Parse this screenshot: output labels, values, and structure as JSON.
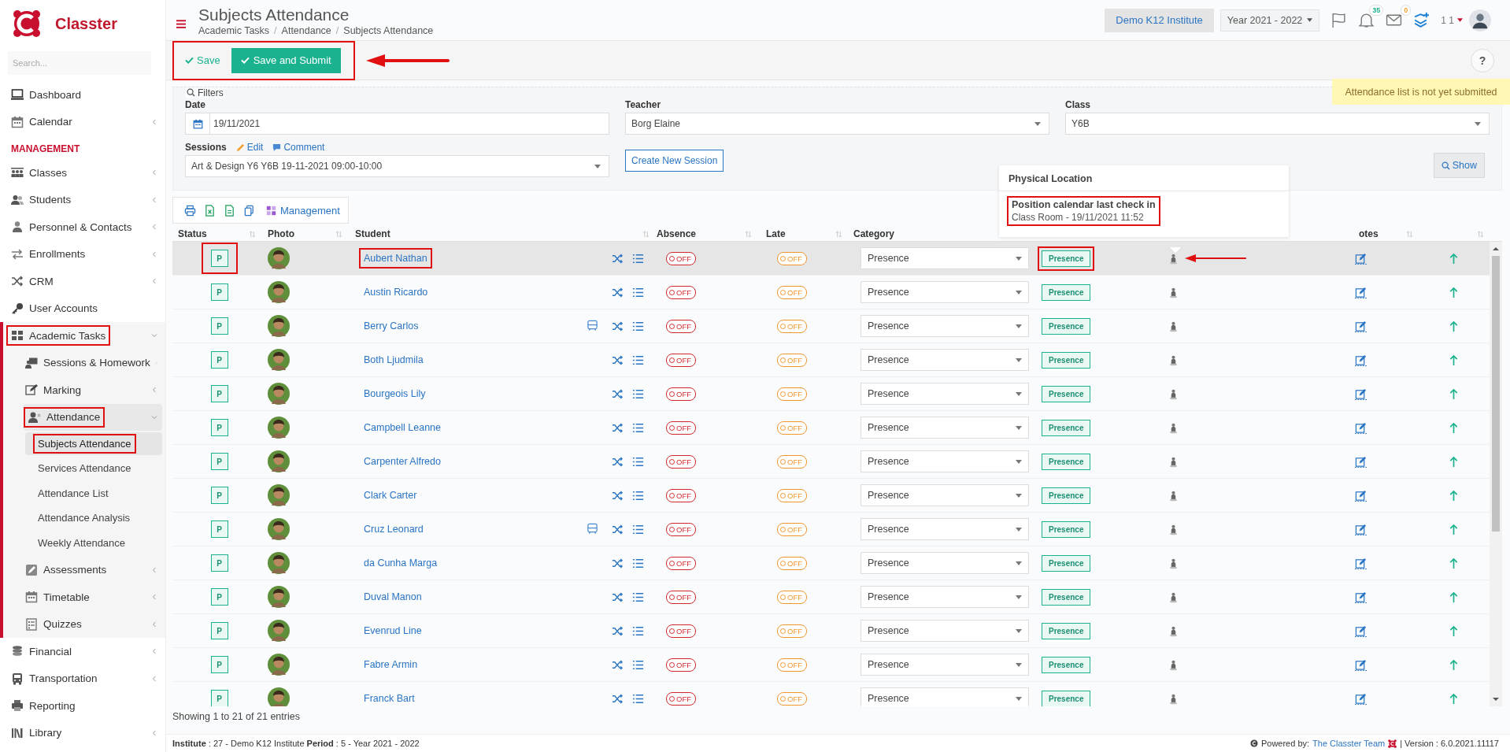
{
  "sidebar": {
    "brand": "Classter",
    "search": {
      "placeholder": "Search..."
    },
    "items": [
      {
        "kind": "link",
        "label": "Dashboard",
        "selected": false
      },
      {
        "kind": "link",
        "label": "Calendar",
        "expanded": false,
        "selected": false
      },
      {
        "kind": "section",
        "label": "MANAGEMENT"
      },
      {
        "kind": "link",
        "label": "Classes",
        "expanded": false,
        "selected": false
      },
      {
        "kind": "link",
        "label": "Students",
        "expanded": false,
        "selected": false
      },
      {
        "kind": "link",
        "label": "Personnel & Contacts",
        "expanded": false,
        "selected": false
      },
      {
        "kind": "link",
        "label": "Enrollments",
        "expanded": false,
        "selected": false
      },
      {
        "kind": "link",
        "label": "CRM",
        "expanded": false,
        "selected": false
      },
      {
        "kind": "link",
        "label": "User Accounts",
        "selected": false
      },
      {
        "kind": "link",
        "label": "Academic Tasks",
        "expanded": true,
        "selected": false,
        "annotated": true,
        "children": [
          {
            "label": "Sessions & Homework",
            "expanded": false,
            "selected": false
          },
          {
            "label": "Marking",
            "expanded": false,
            "selected": false
          },
          {
            "label": "Attendance",
            "expanded": true,
            "selected": true,
            "annotated": true,
            "children": [
              {
                "label": "Subjects Attendance",
                "selected": true,
                "annotated": true
              },
              {
                "label": "Services Attendance",
                "selected": false
              },
              {
                "label": "Attendance List",
                "selected": false
              },
              {
                "label": "Attendance Analysis",
                "selected": false
              },
              {
                "label": "Weekly Attendance",
                "selected": false
              }
            ]
          },
          {
            "label": "Assessments",
            "expanded": false,
            "selected": false
          },
          {
            "label": "Timetable",
            "expanded": false,
            "selected": false
          },
          {
            "label": "Quizzes",
            "expanded": false,
            "selected": false
          }
        ]
      },
      {
        "kind": "link",
        "label": "Financial",
        "expanded": false,
        "selected": false
      },
      {
        "kind": "link",
        "label": "Transportation",
        "expanded": false,
        "selected": false
      },
      {
        "kind": "link",
        "label": "Reporting",
        "selected": false
      },
      {
        "kind": "link",
        "label": "Library",
        "expanded": false,
        "selected": false
      }
    ]
  },
  "header": {
    "title": "Subjects Attendance",
    "breadcrumbs": [
      "Academic Tasks",
      "Attendance",
      "Subjects Attendance"
    ],
    "separator": "/",
    "institute": "Demo K12 Institute",
    "year": "Year 2021 - 2022",
    "notifications": "35",
    "messages": "0",
    "user": "1 1"
  },
  "toolbar": {
    "annotated": true,
    "save": "Save",
    "save_submit": "Save and Submit",
    "help": "?"
  },
  "notice": "Attendance list is not yet submitted",
  "filters": {
    "legend": "Filters",
    "date": {
      "label": "Date",
      "value": "19/11/2021"
    },
    "teacher": {
      "label": "Teacher",
      "value": "Borg Elaine"
    },
    "class": {
      "label": "Class",
      "value": "Y6B"
    },
    "sessions": {
      "label": "Sessions",
      "edit": "Edit",
      "comment": "Comment",
      "value": "Art & Design Y6 Y6B 19-11-2021 09:00-10:00"
    },
    "create_session": "Create New Session",
    "show": "Show"
  },
  "table": {
    "management": "Management",
    "columns": [
      {
        "label": "Status",
        "sortable": true
      },
      {
        "label": "Photo",
        "sortable": true
      },
      {
        "label": "Student",
        "sortable": false
      },
      {
        "sortable": true
      },
      {
        "label": "Absence",
        "sortable": true
      },
      {
        "label": "Late",
        "sortable": true
      },
      {
        "label": "Category",
        "sortable": false
      },
      {
        "label": "otes",
        "sortable": true
      },
      {
        "sortable": true
      }
    ],
    "popover": {
      "title": "Physical Location",
      "heading": "Position calendar last check in",
      "detail": "Class Room - 19/11/2021 11:52",
      "annotated": true
    },
    "rows": [
      {
        "status": "P",
        "name": "Aubert Nathan",
        "transport": false,
        "absence": "OFF",
        "absent": false,
        "late_text": "OFF",
        "late": false,
        "category": "Presence",
        "badge": "Presence",
        "selected": true,
        "annotated": true
      },
      {
        "status": "P",
        "name": "Austin Ricardo",
        "transport": false,
        "absence": "OFF",
        "absent": false,
        "late_text": "OFF",
        "late": false,
        "category": "Presence",
        "badge": "Presence",
        "selected": false
      },
      {
        "status": "P",
        "name": "Berry Carlos",
        "transport": true,
        "absence": "OFF",
        "absent": false,
        "late_text": "OFF",
        "late": false,
        "category": "Presence",
        "badge": "Presence",
        "selected": false
      },
      {
        "status": "P",
        "name": "Both Ljudmila",
        "transport": false,
        "absence": "OFF",
        "absent": false,
        "late_text": "OFF",
        "late": false,
        "category": "Presence",
        "badge": "Presence",
        "selected": false
      },
      {
        "status": "P",
        "name": "Bourgeois Lily",
        "transport": false,
        "absence": "OFF",
        "absent": false,
        "late_text": "OFF",
        "late": false,
        "category": "Presence",
        "badge": "Presence",
        "selected": false
      },
      {
        "status": "P",
        "name": "Campbell Leanne",
        "transport": false,
        "absence": "OFF",
        "absent": false,
        "late_text": "OFF",
        "late": false,
        "category": "Presence",
        "badge": "Presence",
        "selected": false
      },
      {
        "status": "P",
        "name": "Carpenter Alfredo",
        "transport": false,
        "absence": "OFF",
        "absent": false,
        "late_text": "OFF",
        "late": false,
        "category": "Presence",
        "badge": "Presence",
        "selected": false
      },
      {
        "status": "P",
        "name": "Clark Carter",
        "transport": false,
        "absence": "OFF",
        "absent": false,
        "late_text": "OFF",
        "late": false,
        "category": "Presence",
        "badge": "Presence",
        "selected": false
      },
      {
        "status": "P",
        "name": "Cruz Leonard",
        "transport": true,
        "absence": "OFF",
        "absent": false,
        "late_text": "OFF",
        "late": false,
        "category": "Presence",
        "badge": "Presence",
        "selected": false
      },
      {
        "status": "P",
        "name": "da Cunha Marga",
        "transport": false,
        "absence": "OFF",
        "absent": false,
        "late_text": "OFF",
        "late": false,
        "category": "Presence",
        "badge": "Presence",
        "selected": false
      },
      {
        "status": "P",
        "name": "Duval Manon",
        "transport": false,
        "absence": "OFF",
        "absent": false,
        "late_text": "OFF",
        "late": false,
        "category": "Presence",
        "badge": "Presence",
        "selected": false
      },
      {
        "status": "P",
        "name": "Evenrud Line",
        "transport": false,
        "absence": "OFF",
        "absent": false,
        "late_text": "OFF",
        "late": false,
        "category": "Presence",
        "badge": "Presence",
        "selected": false
      },
      {
        "status": "P",
        "name": "Fabre Armin",
        "transport": false,
        "absence": "OFF",
        "absent": false,
        "late_text": "OFF",
        "late": false,
        "category": "Presence",
        "badge": "Presence",
        "selected": false
      },
      {
        "status": "P",
        "name": "Franck Bart",
        "transport": false,
        "absence": "OFF",
        "absent": false,
        "late_text": "OFF",
        "late": false,
        "category": "Presence",
        "badge": "Presence",
        "selected": false
      }
    ],
    "info": "Showing 1 to 21 of 21 entries"
  },
  "footer": {
    "info": "**Institute** : 27 - Demo K12 Institute **Period** : 5 - Year 2021 - 2022",
    "powered_by": "Powered by:",
    "team": "The Classter Team",
    "version": "| Version : 6.0.2021.11117"
  }
}
